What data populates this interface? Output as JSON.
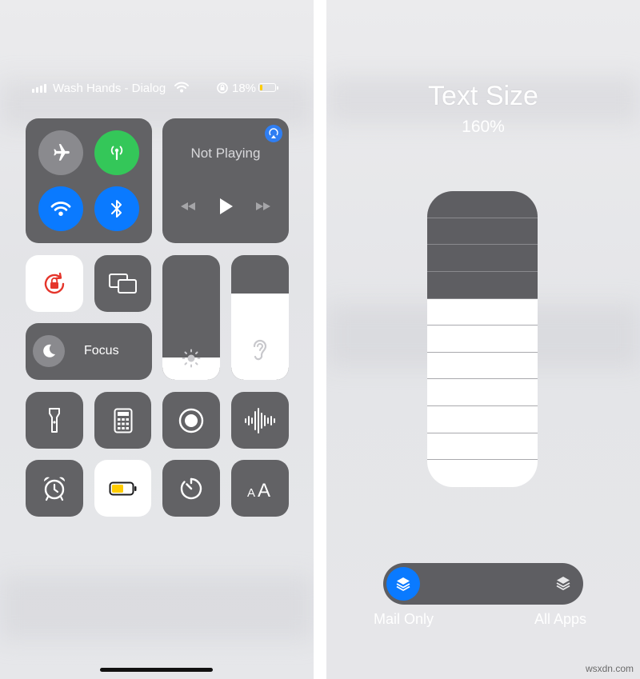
{
  "status_bar": {
    "carrier": "Wash Hands - Dialog",
    "battery_percent": "18%",
    "battery_level": 0.18
  },
  "connectivity": {
    "airplane_mode": "off",
    "cellular_data": "on",
    "wifi": "on",
    "bluetooth": "on"
  },
  "now_playing": {
    "title": "Not Playing"
  },
  "focus": {
    "label": "Focus"
  },
  "sliders": {
    "brightness_level": 0.18,
    "volume_level": 0.69
  },
  "text_size": {
    "title": "Text Size",
    "value": "160%",
    "steps_total": 11,
    "steps_active": 7
  },
  "scope_toggle": {
    "left_label": "Mail Only",
    "right_label": "All Apps",
    "selected": "Mail Only"
  },
  "watermark": "wsxdn.com",
  "colors": {
    "accent_blue": "#0a7aff",
    "green": "#34c759",
    "tile_dark": "#626265",
    "battery_yellow": "#ffcc00",
    "rotation_lock_red": "#e5352b"
  }
}
